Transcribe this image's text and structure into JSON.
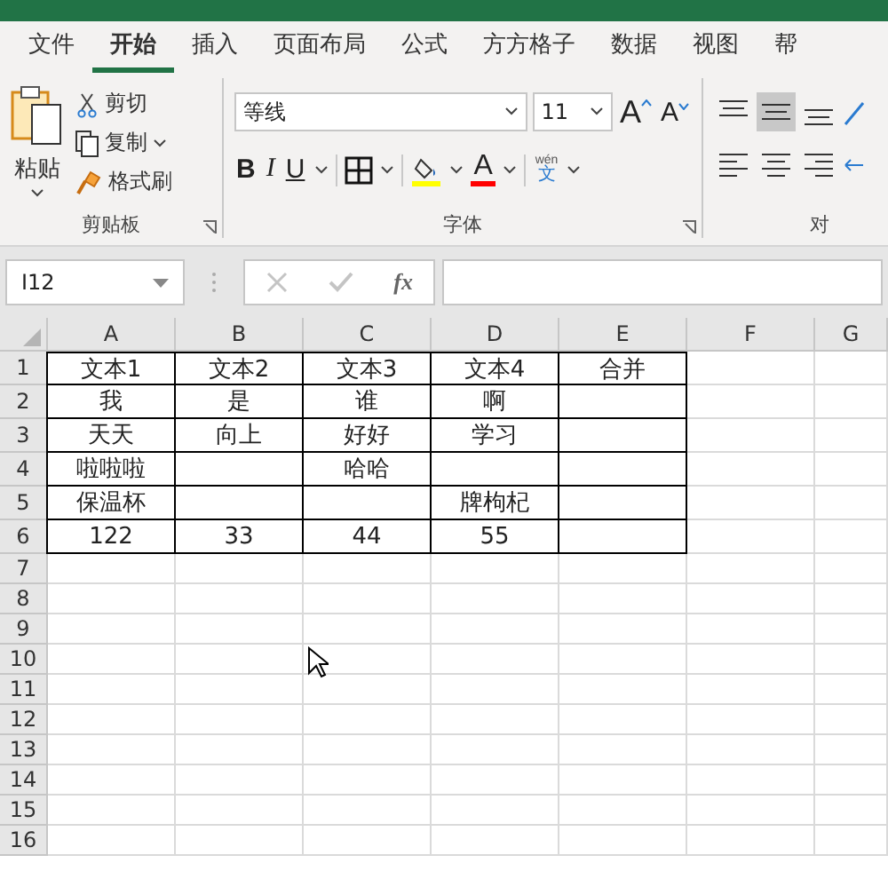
{
  "tabs": [
    {
      "label": "文件",
      "selected": false
    },
    {
      "label": "开始",
      "selected": true
    },
    {
      "label": "插入",
      "selected": false
    },
    {
      "label": "页面布局",
      "selected": false
    },
    {
      "label": "公式",
      "selected": false
    },
    {
      "label": "方方格子",
      "selected": false
    },
    {
      "label": "数据",
      "selected": false
    },
    {
      "label": "视图",
      "selected": false
    },
    {
      "label": "帮",
      "selected": false
    }
  ],
  "clipboard": {
    "paste": "粘贴",
    "cut": "剪切",
    "copy": "复制",
    "format_painter": "格式刷",
    "group_label": "剪贴板"
  },
  "font": {
    "name": "等线",
    "size": "11",
    "grow": "A",
    "shrink": "A",
    "bold": "B",
    "italic": "I",
    "underline": "U",
    "font_color": "A",
    "phonetic_top": "wén",
    "phonetic_char": "文",
    "group_label": "字体"
  },
  "alignment": {
    "group_label": "对"
  },
  "formula_bar": {
    "name_box": "I12",
    "fx": "fx"
  },
  "sheet": {
    "columns": [
      "A",
      "B",
      "C",
      "D",
      "E",
      "F",
      "G"
    ],
    "rows": [
      {
        "label": "1",
        "bordered": true,
        "cells": [
          "文本1",
          "文本2",
          "文本3",
          "文本4",
          "合并"
        ]
      },
      {
        "label": "2",
        "bordered": true,
        "cells": [
          "我",
          "是",
          "谁",
          "啊",
          ""
        ]
      },
      {
        "label": "3",
        "bordered": true,
        "cells": [
          "天天",
          "向上",
          "好好",
          "学习",
          ""
        ]
      },
      {
        "label": "4",
        "bordered": true,
        "cells": [
          "啦啦啦",
          "",
          "哈哈",
          "",
          ""
        ]
      },
      {
        "label": "5",
        "bordered": true,
        "cells": [
          "保温杯",
          "",
          "",
          "牌枸杞",
          ""
        ]
      },
      {
        "label": "6",
        "bordered": true,
        "cells": [
          "122",
          "33",
          "44",
          "55",
          ""
        ]
      },
      {
        "label": "7",
        "bordered": false
      },
      {
        "label": "8",
        "bordered": false
      },
      {
        "label": "9",
        "bordered": false
      },
      {
        "label": "10",
        "bordered": false
      },
      {
        "label": "11",
        "bordered": false
      },
      {
        "label": "12",
        "bordered": false
      },
      {
        "label": "13",
        "bordered": false
      },
      {
        "label": "14",
        "bordered": false
      },
      {
        "label": "15",
        "bordered": false
      },
      {
        "label": "16",
        "bordered": false
      }
    ]
  }
}
